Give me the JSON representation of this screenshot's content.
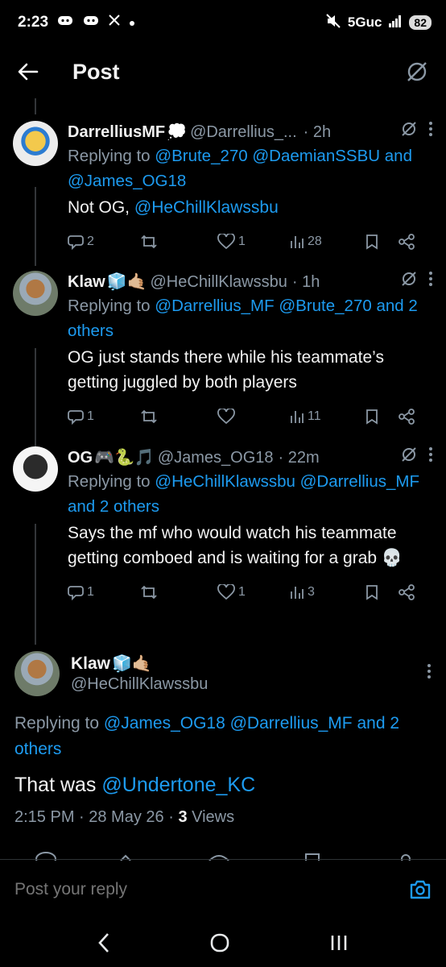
{
  "status_bar": {
    "time": "2:23",
    "network": "5Guc",
    "battery": "82"
  },
  "header": {
    "title": "Post"
  },
  "replies": [
    {
      "name": "DarrelliusMF",
      "emoji": "💭",
      "handle": "@Darrellius_...",
      "time": "· 2h",
      "replying_prefix": "Replying to",
      "replying_mentions": "@Brute_270 @DaemianSSBU",
      "replying_and": "and",
      "replying_more": "@James_OG18",
      "text_plain": "Not OG,",
      "text_mention": "@HeChillKlawssbu",
      "text_rest": "",
      "replies": "2",
      "retweets": "",
      "likes": "1",
      "views": "28"
    },
    {
      "name": "Klaw",
      "emoji": "🧊🤙🏼",
      "handle": "@HeChillKlawssbu",
      "time": "· 1h",
      "replying_prefix": "Replying to",
      "replying_mentions": "@Darrellius_MF @Brute_270",
      "replying_and": "and",
      "replying_more": "2 others",
      "text_plain": "OG just stands there while his teammate’s getting juggled by both players",
      "text_mention": "",
      "text_rest": "",
      "replies": "1",
      "retweets": "",
      "likes": "",
      "views": "11"
    },
    {
      "name": "OG",
      "emoji": "🎮🐍🎵",
      "handle": "@James_OG18",
      "time": "· 22m",
      "replying_prefix": "Replying to",
      "replying_mentions": "@HeChillKlawssbu",
      "replying_and": "@Darrellius_MF and",
      "replying_more": "2 others",
      "text_plain": "Says the mf who would watch his teammate getting comboed and is waiting for a grab 💀",
      "text_mention": "",
      "text_rest": "",
      "replies": "1",
      "retweets": "",
      "likes": "1",
      "views": "3"
    }
  ],
  "main": {
    "name": "Klaw",
    "emoji": "🧊🤙🏼",
    "handle": "@HeChillKlawssbu",
    "replying_prefix": "Replying to",
    "replying_mentions": "@James_OG18 @Darrellius_MF and 2 others",
    "text_plain": "That was",
    "text_mention": "@Undertone_KC",
    "timestamp": "2:15 PM · 28 May 26 ·",
    "views_count": "3",
    "views_label": "Views"
  },
  "reply_bar": {
    "placeholder": "Post your reply"
  },
  "colors": {
    "accent": "#1d9bf0",
    "muted": "#8b98a5",
    "background": "#000000"
  }
}
